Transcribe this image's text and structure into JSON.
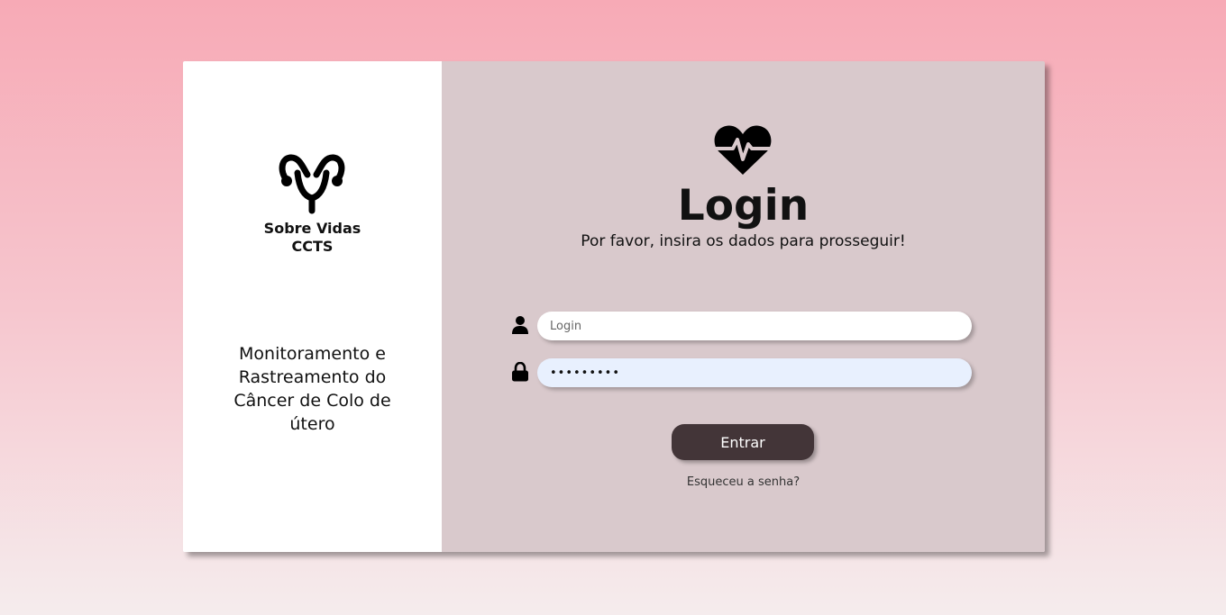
{
  "brand": {
    "line1": "Sobre Vidas",
    "line2": "CCTS",
    "icon": "uterus-icon",
    "tagline": "Monitoramento e Rastreamento do Câncer de Colo de útero"
  },
  "login": {
    "icon": "heart-pulse-icon",
    "title": "Login",
    "subtitle": "Por favor, insira os dados para prosseguir!",
    "username": {
      "icon": "user-icon",
      "placeholder": "Login",
      "value": ""
    },
    "password": {
      "icon": "lock-icon",
      "value": "123456789"
    },
    "submit_label": "Entrar",
    "forgot_label": "Esqueceu a senha?"
  },
  "colors": {
    "accent": "#433538",
    "panel": "#d9c9cc",
    "background_top": "#f7aab6",
    "background_bottom": "#f5eced"
  }
}
